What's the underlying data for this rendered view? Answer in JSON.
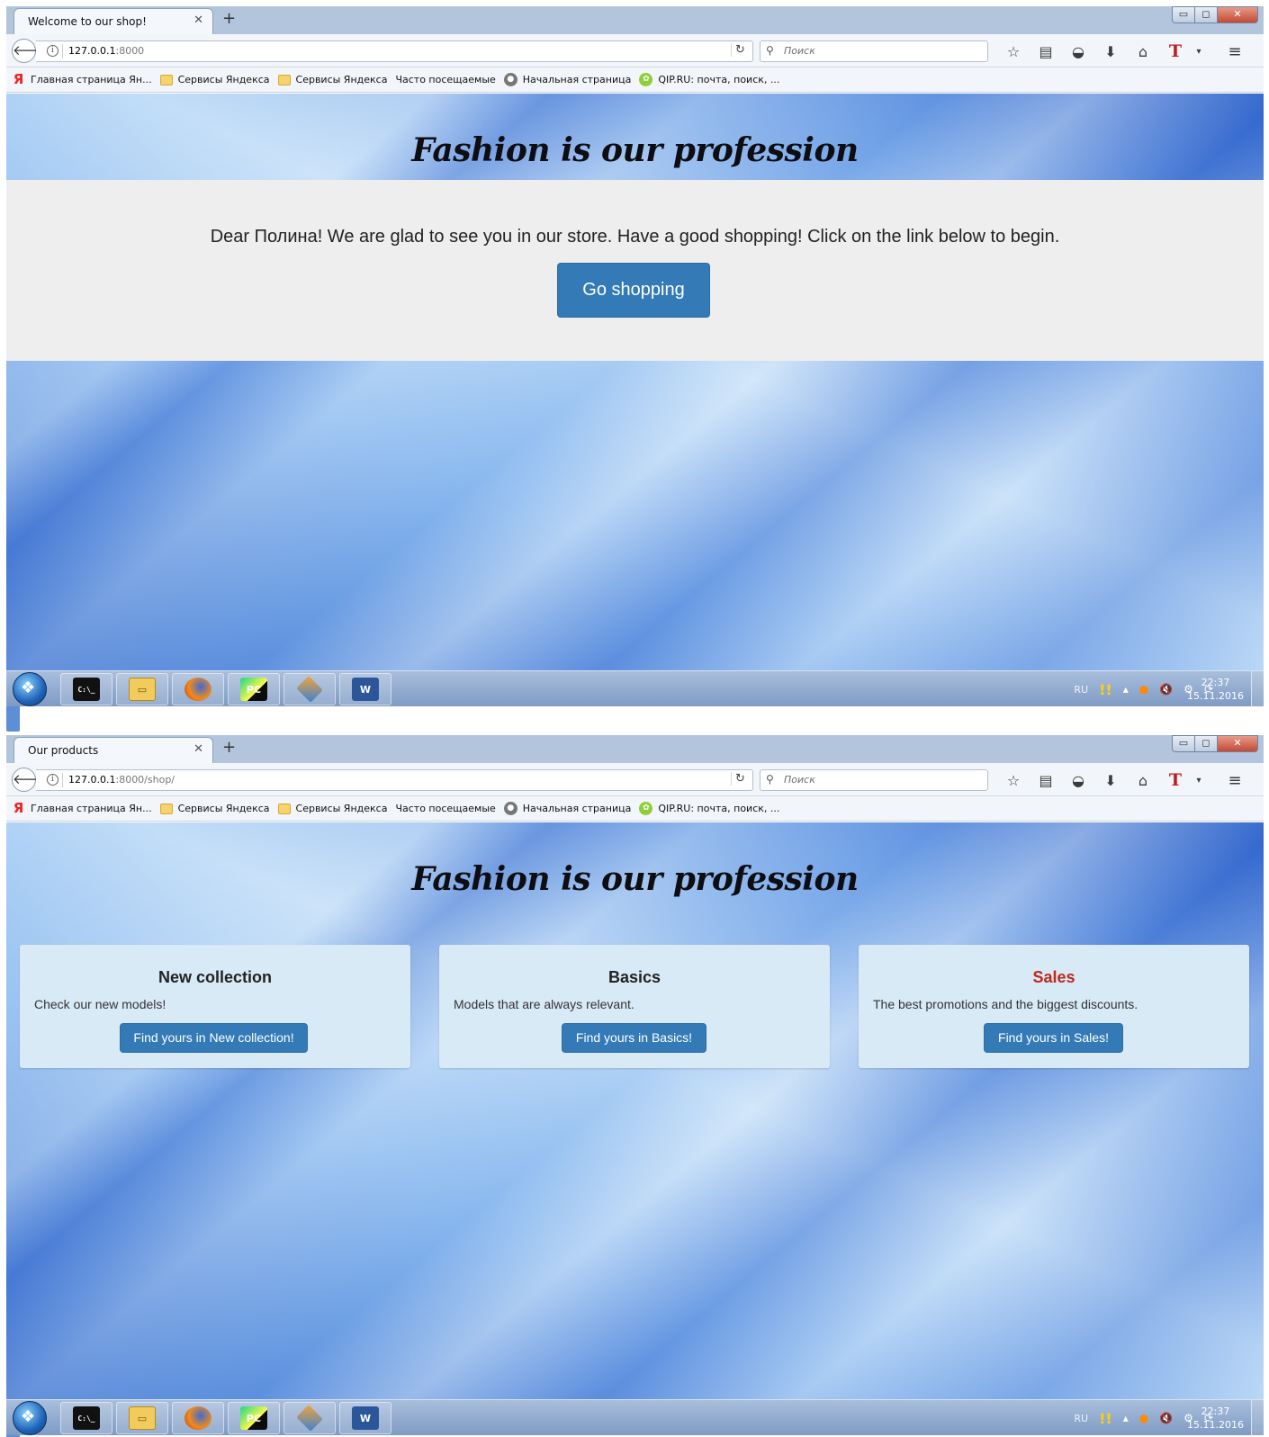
{
  "browser": {
    "window_controls": {
      "minimize": "▭",
      "maximize": "◻",
      "close": "✕"
    },
    "search_placeholder": "Поиск",
    "bookmarks": [
      {
        "label": "Главная страница Ян...",
        "icon": "Я"
      },
      {
        "label": "Сервисы Яндекса",
        "icon": ""
      },
      {
        "label": "Сервисы Яндекса",
        "icon": ""
      },
      {
        "label": "Часто посещаемые",
        "icon": "↗"
      },
      {
        "label": "Начальная страница",
        "icon": "●"
      },
      {
        "label": "QIP.RU: почта, поиск, ...",
        "icon": "✿"
      }
    ]
  },
  "screens": [
    {
      "tab_title": "Welcome to our shop!",
      "url_host": "127.0.0.1",
      "url_rest": ":8000",
      "brand": "Fashion is our profession",
      "welcome_text": "Dear Полина! We are glad to see you in our store. Have a good shopping! Click on the link below to begin.",
      "go_shopping_label": "Go shopping"
    },
    {
      "tab_title": "Our products",
      "url_host": "127.0.0.1",
      "url_rest": ":8000/shop/",
      "brand": "Fashion is our profession",
      "cards": [
        {
          "title": "New collection",
          "text": "Check our new models!",
          "button": "Find yours in New collection!"
        },
        {
          "title": "Basics",
          "text": "Models that are always relevant.",
          "button": "Find yours in Basics!"
        },
        {
          "title": "Sales",
          "text": "The best promotions and the biggest discounts.",
          "button": "Find yours in Sales!"
        }
      ]
    }
  ],
  "taskbar": {
    "lang": "RU",
    "time": "22:37",
    "date": "15.11.2016",
    "apps": [
      "command-prompt",
      "file-explorer",
      "firefox",
      "pycharm",
      "git-gui",
      "word"
    ],
    "cmd_icon_text": "C:\\_",
    "pycharm_icon_text": "PC",
    "word_icon_text": "W"
  },
  "colors": {
    "primary_button": "#337ab7",
    "jumbotron_bg": "#eeeeee",
    "card_bg": "#d9eaf7",
    "sales_title": "#c0281a"
  }
}
